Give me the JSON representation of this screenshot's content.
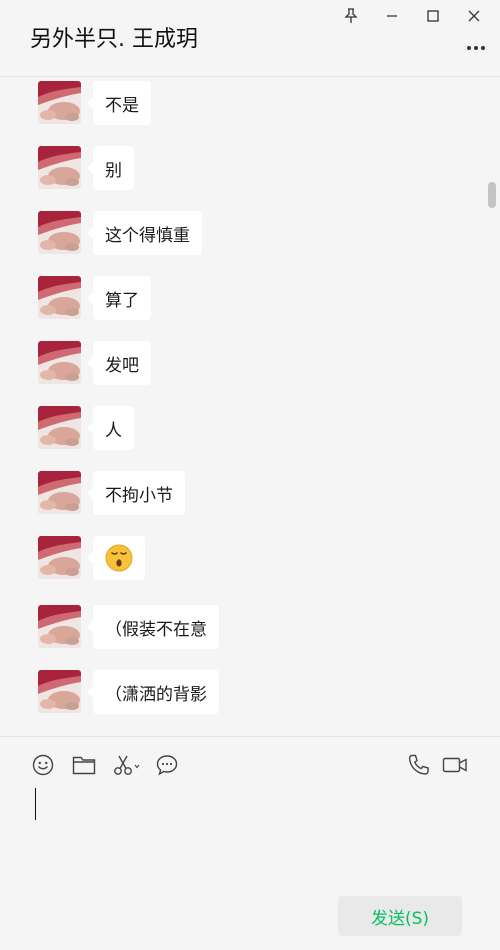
{
  "window": {
    "title": "另外半只. 王成玥"
  },
  "messages": [
    {
      "text": "不是"
    },
    {
      "text": "别"
    },
    {
      "text": "这个得慎重"
    },
    {
      "text": "算了"
    },
    {
      "text": "发吧"
    },
    {
      "text": "人"
    },
    {
      "text": "不拘小节"
    },
    {
      "text": "",
      "emoji": "surprised-face-emoji"
    },
    {
      "text": "（假装不在意"
    },
    {
      "text": "（潇洒的背影"
    }
  ],
  "toolbar": {
    "left_icons": [
      "emoji-icon",
      "folder-icon",
      "scissors-icon",
      "chat-bubble-icon"
    ],
    "right_icons": [
      "phone-icon",
      "video-icon"
    ]
  },
  "input": {
    "value": ""
  },
  "send_button": {
    "label": "发送(S)"
  },
  "colors": {
    "background": "#f5f5f5",
    "bubble": "#ffffff",
    "send_text": "#07c160",
    "send_bg": "#e9e9e9"
  }
}
